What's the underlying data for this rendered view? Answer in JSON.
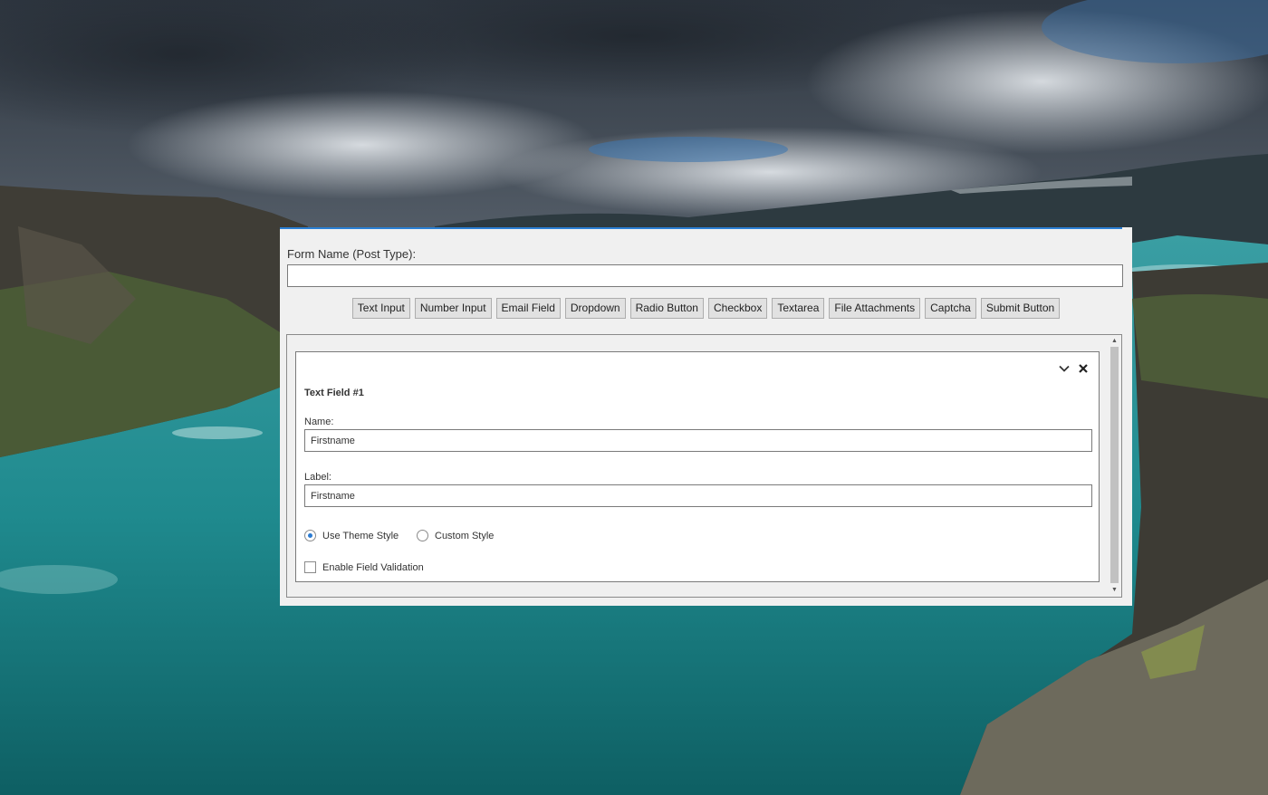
{
  "form": {
    "name_label": "Form Name (Post Type):",
    "name_value": ""
  },
  "toolbar": {
    "buttons": [
      "Text Input",
      "Number Input",
      "Email Field",
      "Dropdown",
      "Radio Button",
      "Checkbox",
      "Textarea",
      "File Attachments",
      "Captcha",
      "Submit Button"
    ]
  },
  "field": {
    "title": "Text Field #1",
    "name_label": "Name:",
    "name_value": "Firstname",
    "label_label": "Label:",
    "label_value": "Firstname",
    "style_options": {
      "theme": "Use Theme Style",
      "custom": "Custom Style",
      "selected": "theme"
    },
    "validation_label": "Enable Field Validation",
    "validation_checked": false
  },
  "icons": {
    "collapse": "chevron-down-icon",
    "close": "close-icon"
  },
  "colors": {
    "accent": "#2a7fd4",
    "dialog_bg": "#f0f0f0"
  }
}
